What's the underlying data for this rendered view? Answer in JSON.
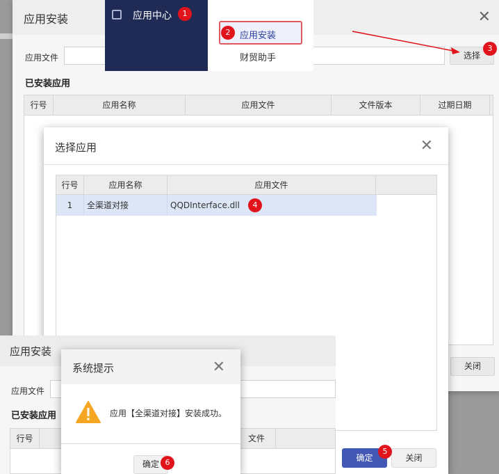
{
  "install_dialog": {
    "title": "应用安装",
    "file_label": "应用文件",
    "select_button": "选择",
    "installed_title": "已安装应用",
    "columns": [
      "行号",
      "应用名称",
      "应用文件",
      "文件版本",
      "过期日期"
    ],
    "close_button": "关闭"
  },
  "menu": {
    "app_center": "应用中心",
    "submenu": [
      "应用安装",
      "财贸助手"
    ]
  },
  "select_dialog": {
    "title": "选择应用",
    "columns": [
      "行号",
      "应用名称",
      "应用文件"
    ],
    "rows": [
      {
        "index": "1",
        "name": "全渠道对接",
        "file": "QQDInterface.dll"
      }
    ],
    "ok_button": "确定",
    "close_button": "关闭"
  },
  "install_dialog_2": {
    "title": "应用安装",
    "file_label": "应用文件",
    "installed_title": "已安装应用",
    "col_index": "行号",
    "col_file_partial": "文件"
  },
  "system_prompt": {
    "title": "系统提示",
    "message": "应用【全渠道对接】安装成功。",
    "ok_button": "确定"
  },
  "badges": [
    "1",
    "2",
    "3",
    "4",
    "5",
    "6"
  ],
  "colors": {
    "menu_bg": "#1f2a55",
    "primary": "#4358b4",
    "badge": "#e1141c",
    "highlight_border": "#e0575e",
    "selected_row": "#dde6f7"
  }
}
